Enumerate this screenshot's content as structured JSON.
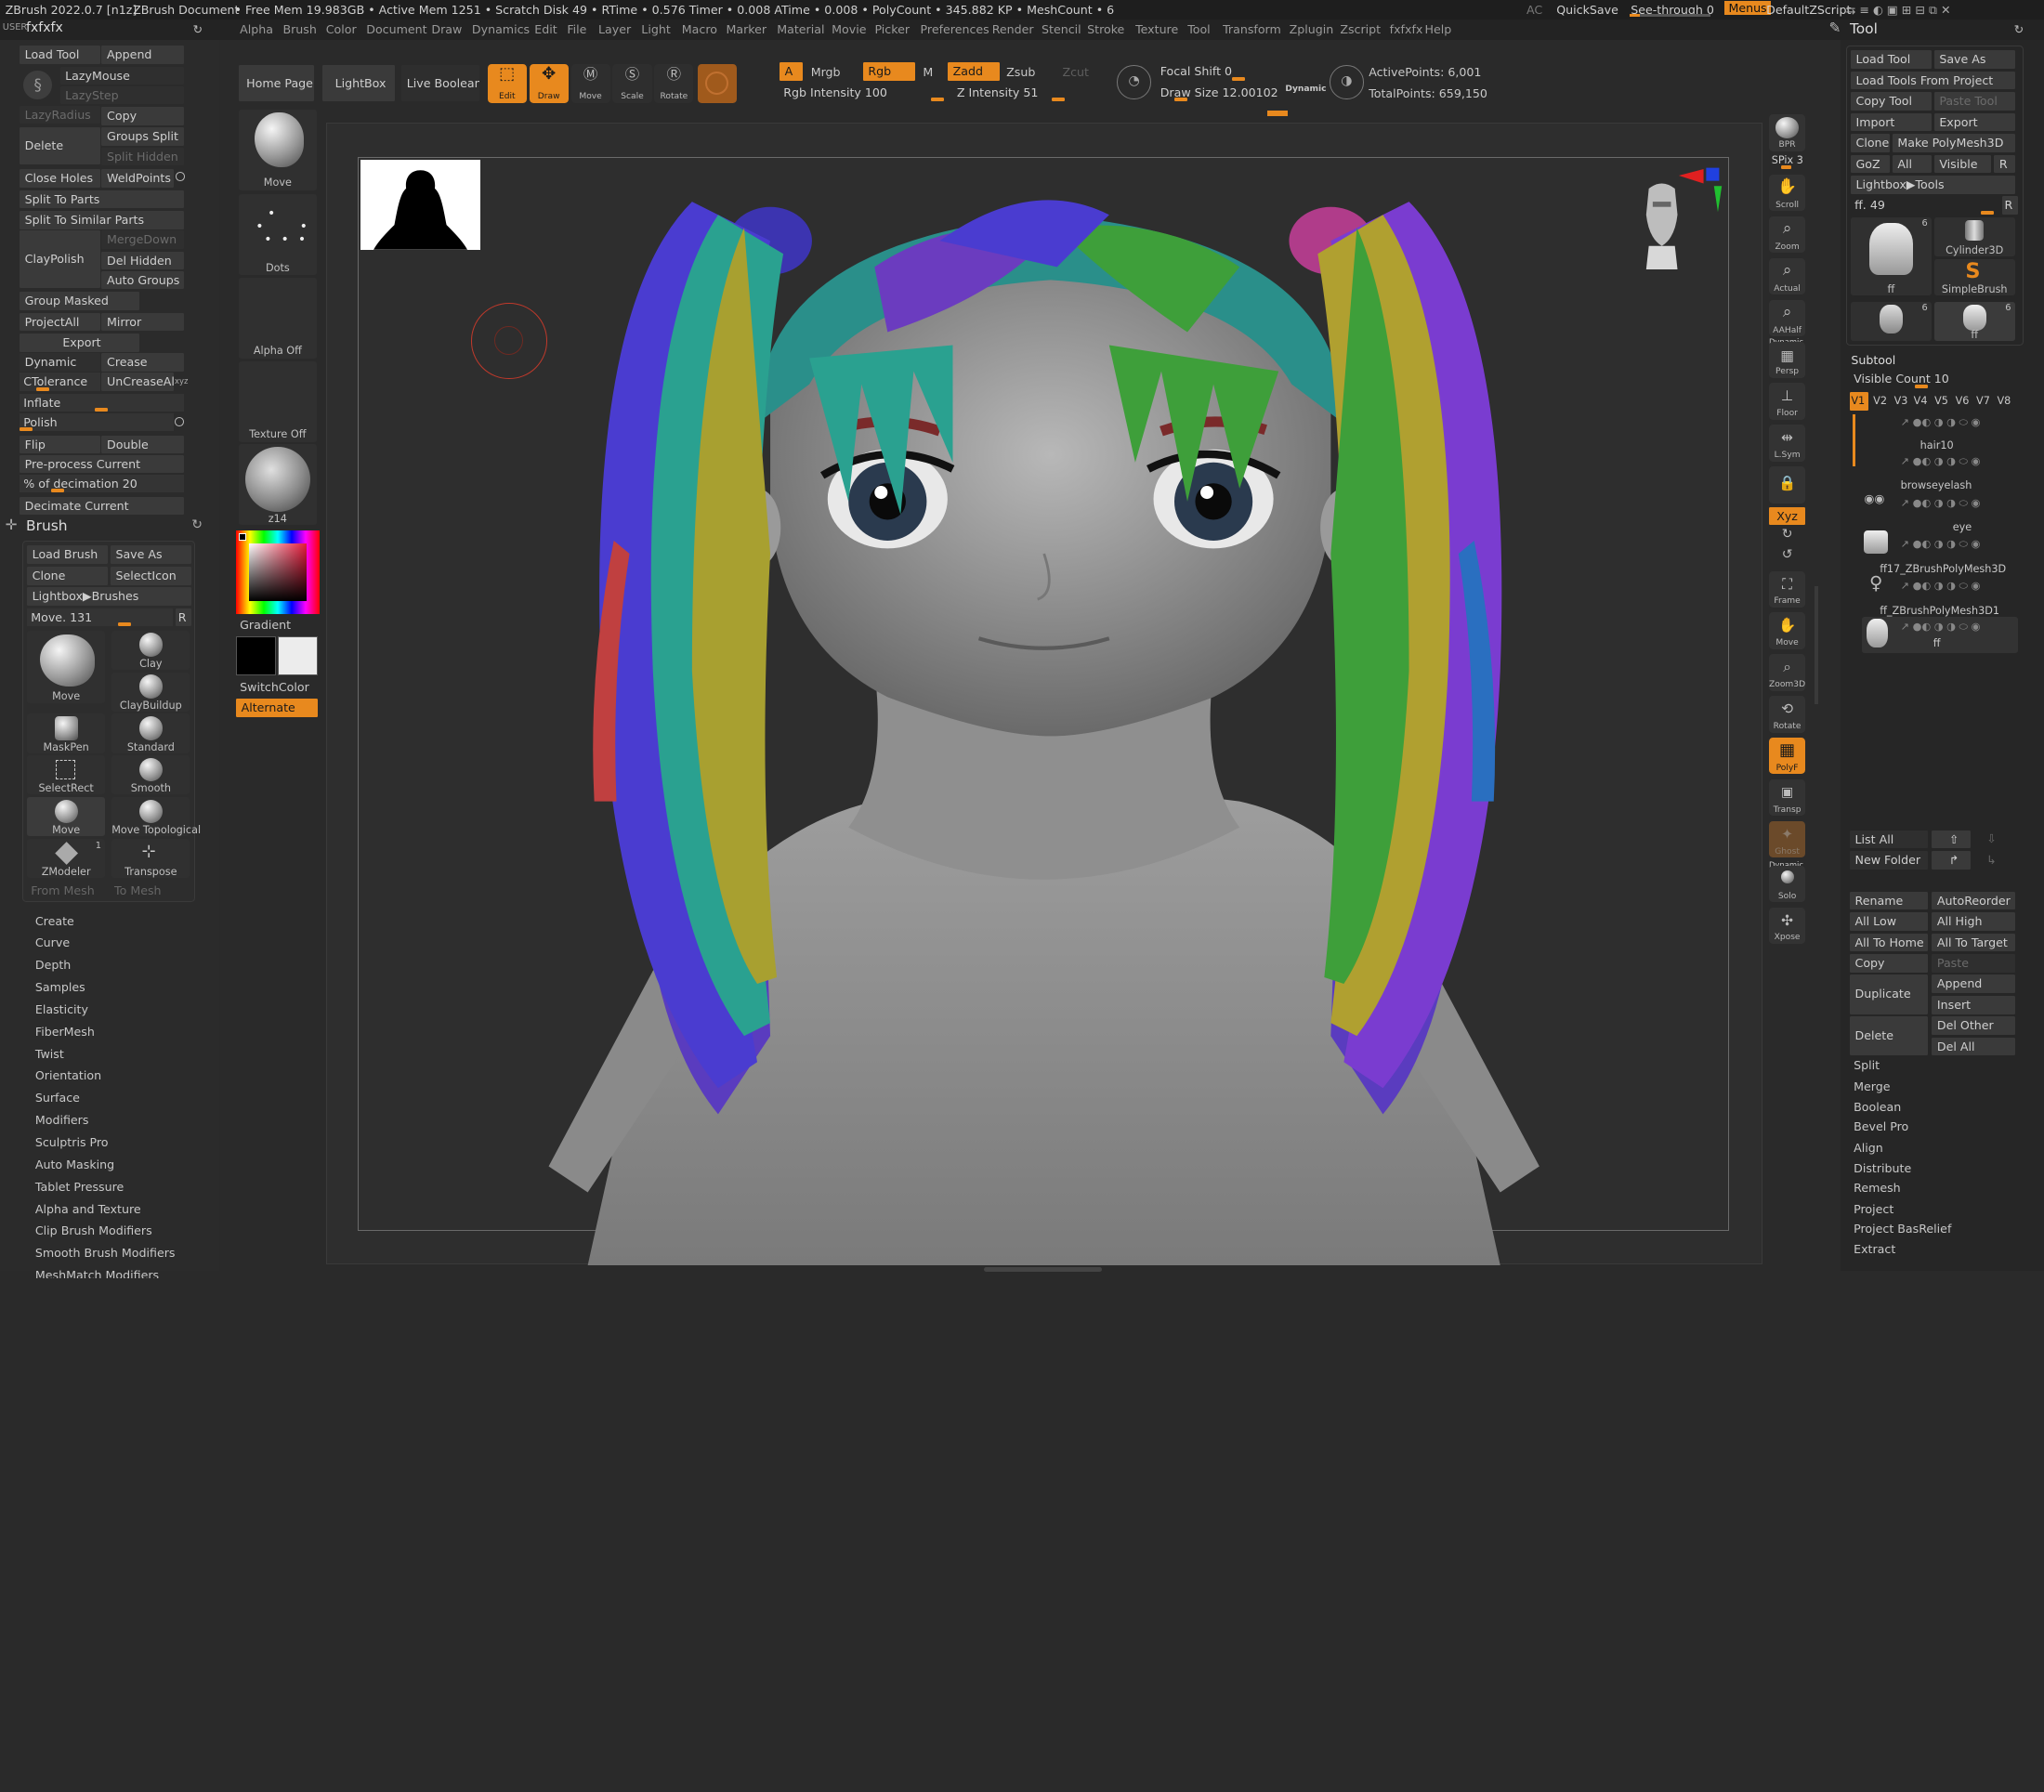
{
  "titlebar": {
    "app": "ZBrush 2022.0.7 [n1z]",
    "doc": "ZBrush Document",
    "stats": "• Free Mem 19.983GB • Active Mem 1251 • Scratch Disk 49 • RTime • 0.576 Timer • 0.008 ATime • 0.008 • PolyCount • 345.882 KP • MeshCount • 6",
    "ac": "AC",
    "quicksave": "QuickSave",
    "seethrough": "See-through 0",
    "menus": "Menus",
    "script": "DefaultZScript"
  },
  "menubar": {
    "items": [
      "Alpha",
      "Brush",
      "Color",
      "Document",
      "Draw",
      "Dynamics",
      "Edit",
      "File",
      "Layer",
      "Light",
      "Macro",
      "Marker",
      "Material",
      "Movie",
      "Picker",
      "Preferences",
      "Render",
      "Stencil",
      "Stroke",
      "Texture",
      "Tool",
      "Transform",
      "Zplugin",
      "Zscript",
      "fxfxfx",
      "Help"
    ],
    "user": "USER",
    "plugin": "fxfxfx",
    "tool_title": "Tool"
  },
  "left_tools": {
    "load_tool": "Load Tool",
    "append": "Append",
    "lazymouse": "LazyMouse",
    "lazystep": "LazyStep",
    "lazyradius": "LazyRadius",
    "copy": "Copy",
    "delete": "Delete",
    "groups_split": "Groups Split",
    "split_hidden": "Split Hidden",
    "close_holes": "Close Holes",
    "weldpoints": "WeldPoints",
    "split_to_parts": "Split To Parts",
    "split_similar": "Split To Similar Parts",
    "claypolish": "ClayPolish",
    "mergedown": "MergeDown",
    "del_hidden": "Del Hidden",
    "auto_groups": "Auto Groups",
    "group_masked": "Group Masked",
    "projectall": "ProjectAll",
    "mirror": "Mirror",
    "export": "Export",
    "dynamic": "Dynamic",
    "crease": "Crease",
    "ctolerance": "CTolerance 45",
    "uncreaseall": "UnCreaseAll",
    "inflate": "Inflate",
    "polish": "Polish",
    "flip": "Flip",
    "double": "Double",
    "preprocess": "Pre-process Current",
    "pct_decimation": "% of decimation 20",
    "decimate_current": "Decimate Current"
  },
  "brush_palette": {
    "title": "Brush",
    "load_brush": "Load Brush",
    "save_as": "Save As",
    "clone": "Clone",
    "selecticon": "SelectIcon",
    "lightbox_brushes": "Lightbox▶Brushes",
    "move_slider": "Move. 131",
    "r": "R",
    "current": "Move",
    "brushes": [
      "Clay",
      "ClayBuildup",
      "MaskPen",
      "Standard",
      "SelectRect",
      "Smooth",
      "Move",
      "Move Topological",
      "ZModeler",
      "Transpose"
    ],
    "zmodeler_count": "1",
    "from_mesh": "From Mesh",
    "to_mesh": "To Mesh",
    "sections": [
      "Create",
      "Curve",
      "Depth",
      "Samples",
      "Elasticity",
      "FiberMesh",
      "Twist",
      "Orientation",
      "Surface",
      "Modifiers",
      "Sculptris Pro",
      "Auto Masking",
      "Tablet Pressure",
      "Alpha and Texture",
      "Clip Brush Modifiers",
      "Smooth Brush Modifiers",
      "MeshMatch Modifiers"
    ]
  },
  "shelf": {
    "move": "Move",
    "dots": "Dots",
    "alpha_off": "Alpha Off",
    "texture_off": "Texture Off",
    "material": "z14",
    "gradient": "Gradient",
    "switchcolor": "SwitchColor",
    "alternate": "Alternate"
  },
  "top_shelf": {
    "home": "Home Page",
    "lightbox": "LightBox",
    "live_boolean": "Live Boolean",
    "edit": "Edit",
    "draw": "Draw",
    "move": "Move",
    "scale": "Scale",
    "rotate": "Rotate",
    "a": "A",
    "mrgb": "Mrgb",
    "rgb": "Rgb",
    "m": "M",
    "zadd": "Zadd",
    "zsub": "Zsub",
    "zcut": "Zcut",
    "rgb_intensity": "Rgb Intensity 100",
    "z_intensity": "Z Intensity 51",
    "focal_shift": "Focal Shift 0",
    "draw_size": "Draw Size 12.00102",
    "dynamic": "Dynamic",
    "active_points": "ActivePoints: 6,001",
    "total_points": "TotalPoints: 659,150"
  },
  "right_shelf": {
    "items": [
      "BPR",
      "SPix 3",
      "Scroll",
      "Zoom",
      "Actual",
      "AAHalf",
      "Persp",
      "Floor",
      "L.Sym",
      "",
      "Xyz",
      "",
      "",
      "Frame",
      "Move",
      "Zoom3D",
      "Rotate",
      "PolyF",
      "Transp",
      "Ghost",
      "Solo",
      "Xpose"
    ],
    "dynamic_label": "Dynamic"
  },
  "tool_panel": {
    "load_tool": "Load Tool",
    "save_as": "Save As",
    "load_from_project": "Load Tools From Project",
    "copy_tool": "Copy Tool",
    "paste_tool": "Paste Tool",
    "import": "Import",
    "export": "Export",
    "clone": "Clone",
    "make_polymesh": "Make PolyMesh3D",
    "goz": "GoZ",
    "all": "All",
    "visible": "Visible",
    "r": "R",
    "lightbox_tools": "Lightbox▶Tools",
    "ff_slider": "ff. 49",
    "thumbs": [
      {
        "label": "ff",
        "count": "6"
      },
      {
        "label": "Cylinder3D",
        "count": ""
      },
      {
        "label": "SimpleBrush",
        "count": ""
      },
      {
        "label": "",
        "count": "6"
      },
      {
        "label": "ff",
        "count": "6"
      }
    ]
  },
  "subtool": {
    "title": "Subtool",
    "visible_count": "Visible Count 10",
    "versions": [
      "V1",
      "V2",
      "V3",
      "V4",
      "V5",
      "V6",
      "V7",
      "V8"
    ],
    "items": [
      "hair10",
      "browseyelash",
      "eye",
      "ff17_ZBrushPolyMesh3D",
      "ff_ZBrushPolyMesh3D1",
      "ff"
    ],
    "list_all": "List All",
    "new_folder": "New Folder",
    "rename": "Rename",
    "autoreorder": "AutoReorder",
    "all_low": "All Low",
    "all_high": "All High",
    "all_to_home": "All To Home",
    "all_to_target": "All To Target",
    "copy": "Copy",
    "paste": "Paste",
    "duplicate": "Duplicate",
    "append": "Append",
    "insert": "Insert",
    "delete": "Delete",
    "del_other": "Del Other",
    "del_all": "Del All",
    "sections": [
      "Split",
      "Merge",
      "Boolean",
      "Bevel Pro",
      "Align",
      "Distribute",
      "Remesh",
      "Project",
      "Project BasRelief",
      "Extract"
    ]
  },
  "colors": {
    "accent": "#e8891e",
    "panel": "#2b2b2b",
    "button": "#3a3a3a"
  }
}
